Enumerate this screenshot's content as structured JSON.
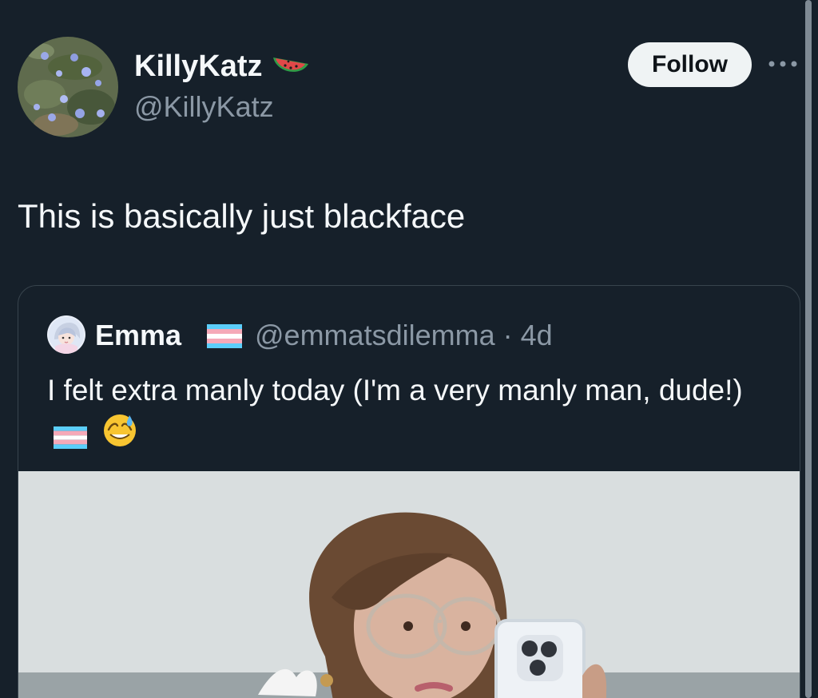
{
  "tweet": {
    "author": {
      "display_name": "KillyKatz",
      "name_emoji": "watermelon",
      "handle": "@KillyKatz",
      "avatar": "flower-avatar"
    },
    "follow_label": "Follow",
    "more_icon": "more-horizontal-icon",
    "text": "This is basically just blackface"
  },
  "quote": {
    "author": {
      "display_name": "Emma",
      "name_emoji": "transgender-flag",
      "handle": "@emmatsdilemma",
      "separator": "·",
      "time": "4d",
      "avatar": "illustrated-avatar"
    },
    "text": "I felt extra manly today (I'm a very manly man, dude!)",
    "text_emojis": [
      "transgender-flag",
      "grinning-sweat-emoji"
    ],
    "media": "selfie-photo"
  },
  "colors": {
    "background": "#16202a",
    "text_primary": "#f5f8fa",
    "text_secondary": "#8b98a5",
    "border": "#38444d",
    "follow_bg": "#eff3f4",
    "follow_text": "#0f1419"
  }
}
